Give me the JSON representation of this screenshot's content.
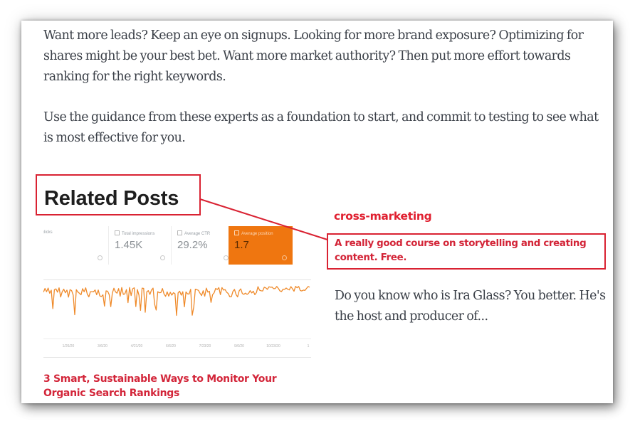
{
  "article": {
    "paragraphs": [
      "Want more leads? Keep an eye on signups. Looking for more brand exposure? Optimizing for shares might be your best bet. Want more market authority? Then put more effort towards ranking for the right keywords.",
      "Use the guidance from these experts as a foundation to start, and commit to testing to see what is most effective for you."
    ]
  },
  "related_posts": {
    "heading": "Related Posts",
    "posts": [
      {
        "title": "3 Smart, Sustainable Ways to Monitor Your Organic Search Rankings",
        "thumbnail": {
          "cards": [
            {
              "label": "clicks",
              "value": "",
              "checked": false,
              "active": false
            },
            {
              "label": "Total impressions",
              "value": "1.45K",
              "checked": false,
              "active": false
            },
            {
              "label": "Average CTR",
              "value": "29.2%",
              "checked": false,
              "active": false
            },
            {
              "label": "Average position",
              "value": "1.7",
              "checked": true,
              "active": true
            }
          ],
          "x_ticks": [
            "1/26/20",
            "3/6/20",
            "4/21/20",
            "6/6/20",
            "7/23/20",
            "9/6/20",
            "10/23/20",
            "1"
          ],
          "series_color": "#ef8a2a"
        }
      },
      {
        "category": "cross-marketing",
        "title": "A really good course on storytelling and creating content. Free.",
        "excerpt": "Do you know who is Ira Glass? You better. He's the host and producer of..."
      }
    ]
  },
  "annotation": {
    "color": "#d92232"
  },
  "colors": {
    "link_red": "#d3263a",
    "card_orange": "#ef7610",
    "body_text": "#3a3f47"
  }
}
